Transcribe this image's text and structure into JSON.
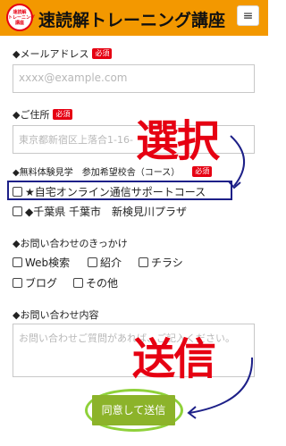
{
  "header": {
    "logo_text": "速読解\nトレーニング\n講座",
    "title": "速読解トレーニング講座",
    "menu_icon": "hamburger-icon"
  },
  "form": {
    "email": {
      "label": "◆メールアドレス",
      "required": "必須",
      "placeholder": "xxxx@example.com"
    },
    "address": {
      "label": "◆ご住所",
      "required": "必須",
      "placeholder": "東京都新宿区上落合1-16-"
    },
    "course": {
      "label": "◆無料体験見学　参加希望校舎（コース）",
      "required": "必須",
      "options": [
        "★自宅オンライン通信サポートコース",
        "◆千葉県 千葉市　新検見川プラザ"
      ]
    },
    "trigger": {
      "label": "◆お問い合わせのきっかけ",
      "options": [
        "Web検索",
        "紹介",
        "チラシ",
        "ブログ",
        "その他"
      ]
    },
    "inquiry": {
      "label": "◆お問い合わせ内容",
      "placeholder": "お問い合わせご質問があれば、ご記入ください。"
    },
    "submit_label": "同意して送信"
  },
  "annotations": {
    "select_text": "選択",
    "send_text": "送信",
    "color": "#e60012",
    "highlight_color": "#1d2088",
    "ring_color": "#8fd13a"
  },
  "colors": {
    "header_bg": "#f39800",
    "required_bg": "#e60012",
    "submit_bg": "#8cb32a"
  }
}
